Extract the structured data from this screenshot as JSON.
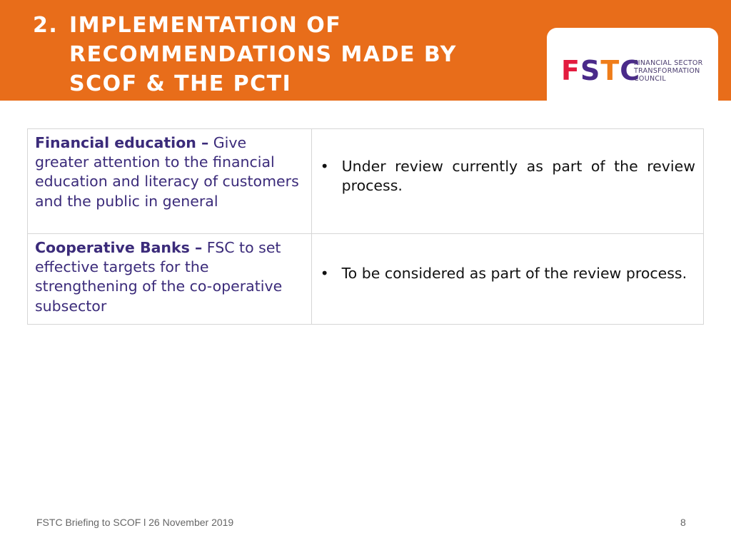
{
  "header": {
    "number": "2.",
    "title_lines": [
      "IMPLEMENTATION OF",
      "RECOMMENDATIONS MADE BY",
      "SCOF & THE PCTI"
    ],
    "background_color": "#e86d1a"
  },
  "logo": {
    "letters": [
      "F",
      "S",
      "T",
      "C"
    ],
    "letter_colors": [
      "#e31b3f",
      "#4a2a8a",
      "#ef7d1a",
      "#4a2a8a"
    ],
    "text_lines": [
      "FINANCIAL SECTOR",
      "TRANSFORMATION",
      "COUNCIL"
    ]
  },
  "table": {
    "rows": [
      {
        "topic": "Financial education –",
        "description": " Give greater attention to the financial education and literacy of customers and the public in general",
        "bullets": [
          "Under review currently as part of the review process."
        ]
      },
      {
        "topic": "Cooperative Banks –",
        "description": " FSC to set effective targets for the strengthening of the co-operative subsector",
        "bullets": [
          "To be considered as part of the review process."
        ]
      }
    ]
  },
  "footer": {
    "caption": "FSTC Briefing to SCOF l 26 November 2019",
    "page_number": "8"
  }
}
